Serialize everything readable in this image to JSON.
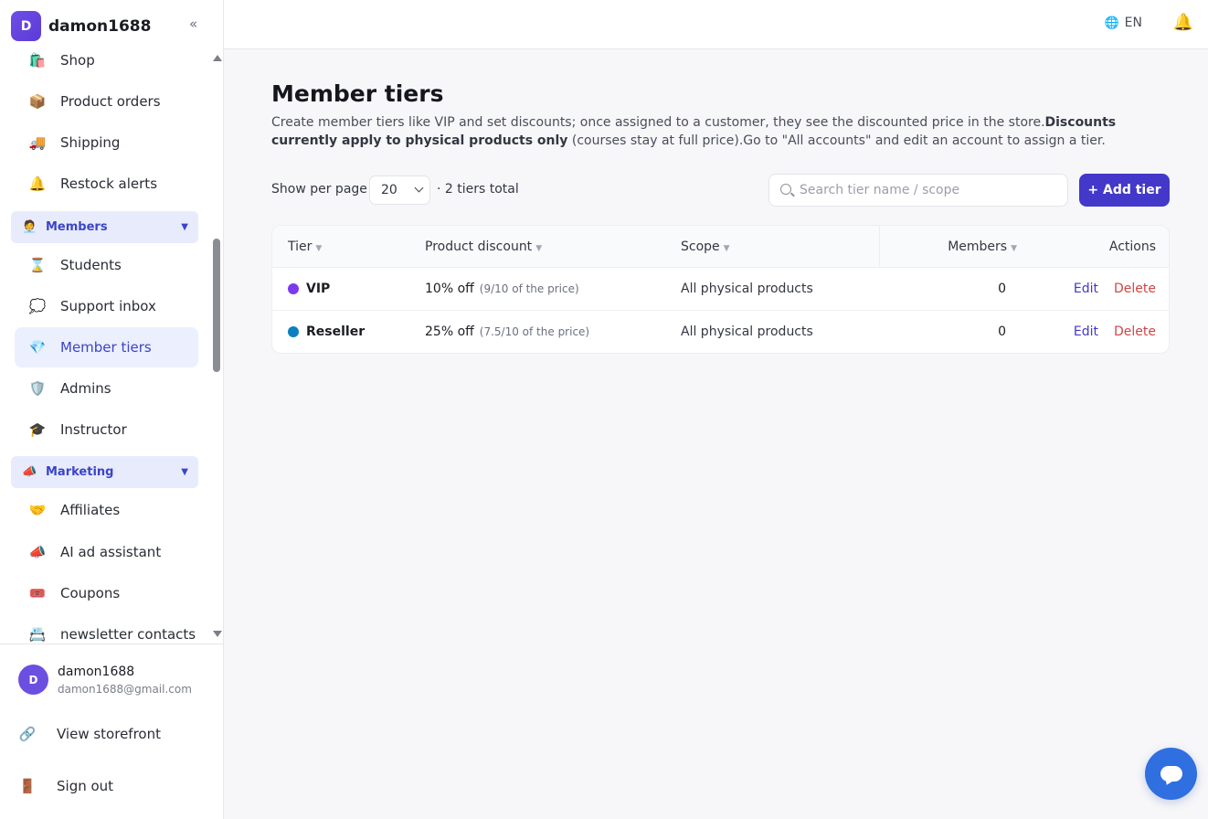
{
  "brand": {
    "initial": "D",
    "name": "damon1688",
    "collapse_glyph": "«"
  },
  "sidebar": {
    "items": [
      {
        "label": "Shop",
        "icon": "shopping-bag-icon",
        "glyph": "🛍️"
      },
      {
        "label": "Product orders",
        "icon": "package-icon",
        "glyph": "📦"
      },
      {
        "label": "Shipping",
        "icon": "truck-icon",
        "glyph": "🚚"
      },
      {
        "label": "Restock alerts",
        "icon": "bell-icon",
        "glyph": "🔔"
      },
      {
        "label": "Members",
        "icon": "members-icon",
        "glyph": "🧑‍💼",
        "group": true
      },
      {
        "label": "Students",
        "icon": "hourglass-icon",
        "glyph": "⌛"
      },
      {
        "label": "Support inbox",
        "icon": "chat-icon",
        "glyph": "💭"
      },
      {
        "label": "Member tiers",
        "icon": "gem-icon",
        "glyph": "💎",
        "active": true
      },
      {
        "label": "Admins",
        "icon": "shield-icon",
        "glyph": "🛡️"
      },
      {
        "label": "Instructor",
        "icon": "graduation-cap-icon",
        "glyph": "🎓"
      },
      {
        "label": "Marketing",
        "icon": "megaphone-icon",
        "glyph": "📣",
        "group": true
      },
      {
        "label": "Affiliates",
        "icon": "handshake-icon",
        "glyph": "🤝"
      },
      {
        "label": "AI ad assistant",
        "icon": "megaphone-icon",
        "glyph": "📣"
      },
      {
        "label": "Coupons",
        "icon": "ticket-icon",
        "glyph": "🎟️"
      },
      {
        "label": "newsletter contacts",
        "icon": "contacts-icon",
        "glyph": "📇"
      }
    ],
    "group_caret": "▼"
  },
  "user": {
    "initial": "D",
    "name": "damon1688",
    "email": "damon1688@gmail.com"
  },
  "footer_links": [
    {
      "label": "View storefront",
      "icon": "link-icon",
      "glyph": "🔗"
    },
    {
      "label": "Sign out",
      "icon": "door-icon",
      "glyph": "🚪"
    }
  ],
  "header": {
    "language": "EN",
    "globe_glyph": "🌐",
    "bell_glyph": "🔔"
  },
  "page": {
    "title": "Member tiers",
    "desc_part1": "Create member tiers like VIP and set discounts; once assigned to a customer, they see the discounted price in the store.",
    "desc_bold": "Discounts currently apply to physical products only",
    "desc_part2": " (courses stay at full price).Go to \"All accounts\" and edit an account to assign a tier."
  },
  "toolbar": {
    "per_page_label": "Show per page",
    "per_page_value": "20",
    "total_label": "· 2 tiers total",
    "search_placeholder": "Search tier name / scope",
    "add_button": "+ Add tier"
  },
  "table": {
    "columns": {
      "tier": "Tier",
      "discount": "Product discount",
      "scope": "Scope",
      "members": "Members",
      "actions": "Actions"
    },
    "sort_glyph": "▼",
    "rows": [
      {
        "tier": "VIP",
        "dot_color": "#7c3aed",
        "discount": "10% off",
        "discount_note": "(9/10 of the price)",
        "scope": "All physical products",
        "members": "0",
        "edit": "Edit",
        "delete": "Delete"
      },
      {
        "tier": "Reseller",
        "dot_color": "#0b7fc1",
        "discount": "25% off",
        "discount_note": "(7.5/10 of the price)",
        "scope": "All physical products",
        "members": "0",
        "edit": "Edit",
        "delete": "Delete"
      }
    ]
  },
  "colors": {
    "accent": "#4338ca",
    "danger": "#d04545",
    "fab": "#2f6fe0"
  }
}
